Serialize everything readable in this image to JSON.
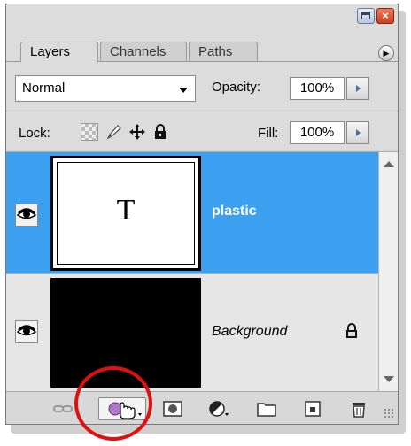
{
  "tabs": [
    {
      "label": "Layers",
      "active": true
    },
    {
      "label": "Channels",
      "active": false
    },
    {
      "label": "Paths",
      "active": false
    }
  ],
  "blend_mode": {
    "value": "Normal"
  },
  "opacity": {
    "label": "Opacity:",
    "value": "100%"
  },
  "lock": {
    "label": "Lock:"
  },
  "fill": {
    "label": "Fill:",
    "value": "100%"
  },
  "layers": [
    {
      "name": "plastic",
      "thumbnail_text": "T",
      "selected": true,
      "visible": true
    },
    {
      "name": "Background",
      "selected": false,
      "visible": true,
      "locked": true
    }
  ],
  "colors": {
    "selected_row": "#3d9ff0",
    "highlight_circle": "#e01010",
    "panel_bg": "#dcdcdc"
  },
  "icons": {
    "title_buttons": [
      "minimize-icon",
      "close-icon"
    ],
    "flyout": "panel-menu-icon",
    "lock_tools": [
      "lock-transparent-icon",
      "lock-image-icon",
      "lock-position-icon",
      "lock-all-icon"
    ],
    "bottom_toolbar": [
      "link-icon",
      "layer-style-icon",
      "mask-icon",
      "adjustment-icon",
      "group-icon",
      "new-layer-icon",
      "trash-icon"
    ]
  }
}
